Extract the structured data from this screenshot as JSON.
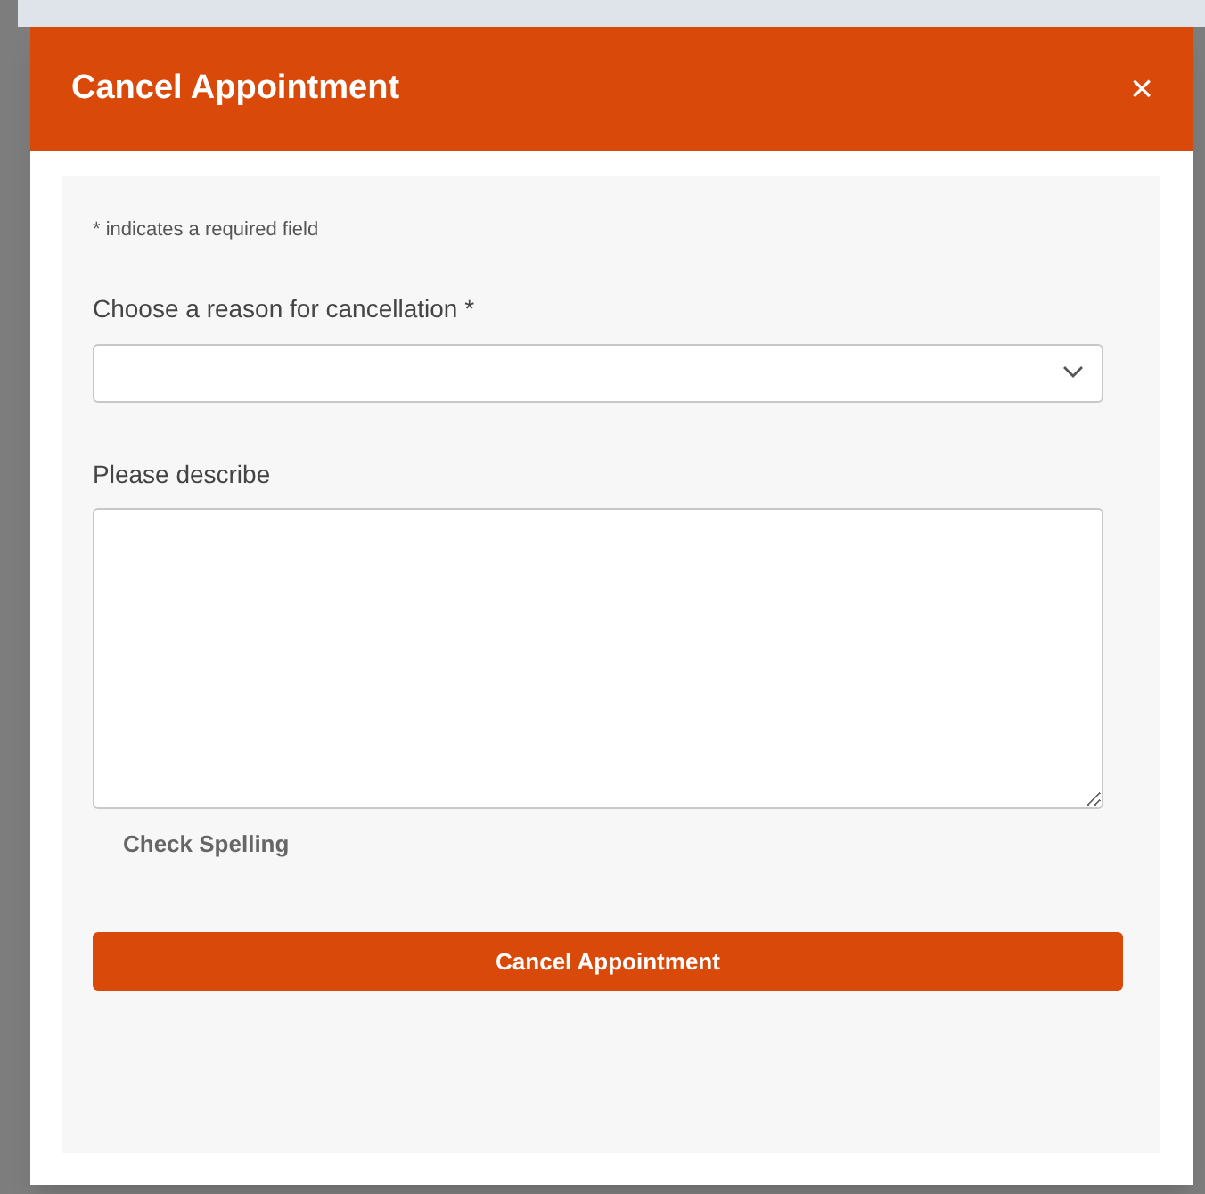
{
  "dialog": {
    "title": "Cancel Appointment",
    "close": "×"
  },
  "required_note": "* indicates a required field",
  "reason": {
    "label": "Choose a reason for cancellation *"
  },
  "description": {
    "label": "Please describe"
  },
  "spell_check": "Check Spelling",
  "submit": "Cancel Appointment"
}
